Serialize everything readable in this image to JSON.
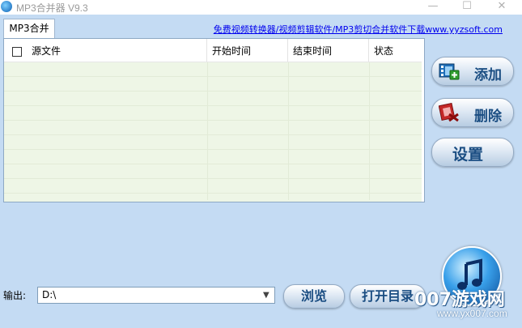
{
  "window": {
    "title": "MP3合并器 V9.3",
    "minimize_glyph": "—",
    "maximize_glyph": "☐",
    "close_glyph": "✕"
  },
  "tab": {
    "label": "MP3合并"
  },
  "top_link": {
    "text": "免费视频转换器/视频剪辑软件/MP3剪切合并软件下载www.yyzsoft.com"
  },
  "table": {
    "columns": [
      "源文件",
      "开始时间",
      "结束时间",
      "状态"
    ],
    "rows": []
  },
  "side_buttons": {
    "add": "添加",
    "delete": "删除",
    "settings": "设置"
  },
  "output": {
    "label": "输出:",
    "path_value": "D:\\",
    "browse_label": "浏览",
    "open_dir_label": "打开目录"
  },
  "watermark": {
    "text": "007游戏网",
    "url": "www.yx007.com"
  },
  "colors": {
    "background": "#c4dbf3",
    "list_background": "#eef6e6",
    "link": "#0000ee",
    "button_text": "#1a4d82"
  }
}
